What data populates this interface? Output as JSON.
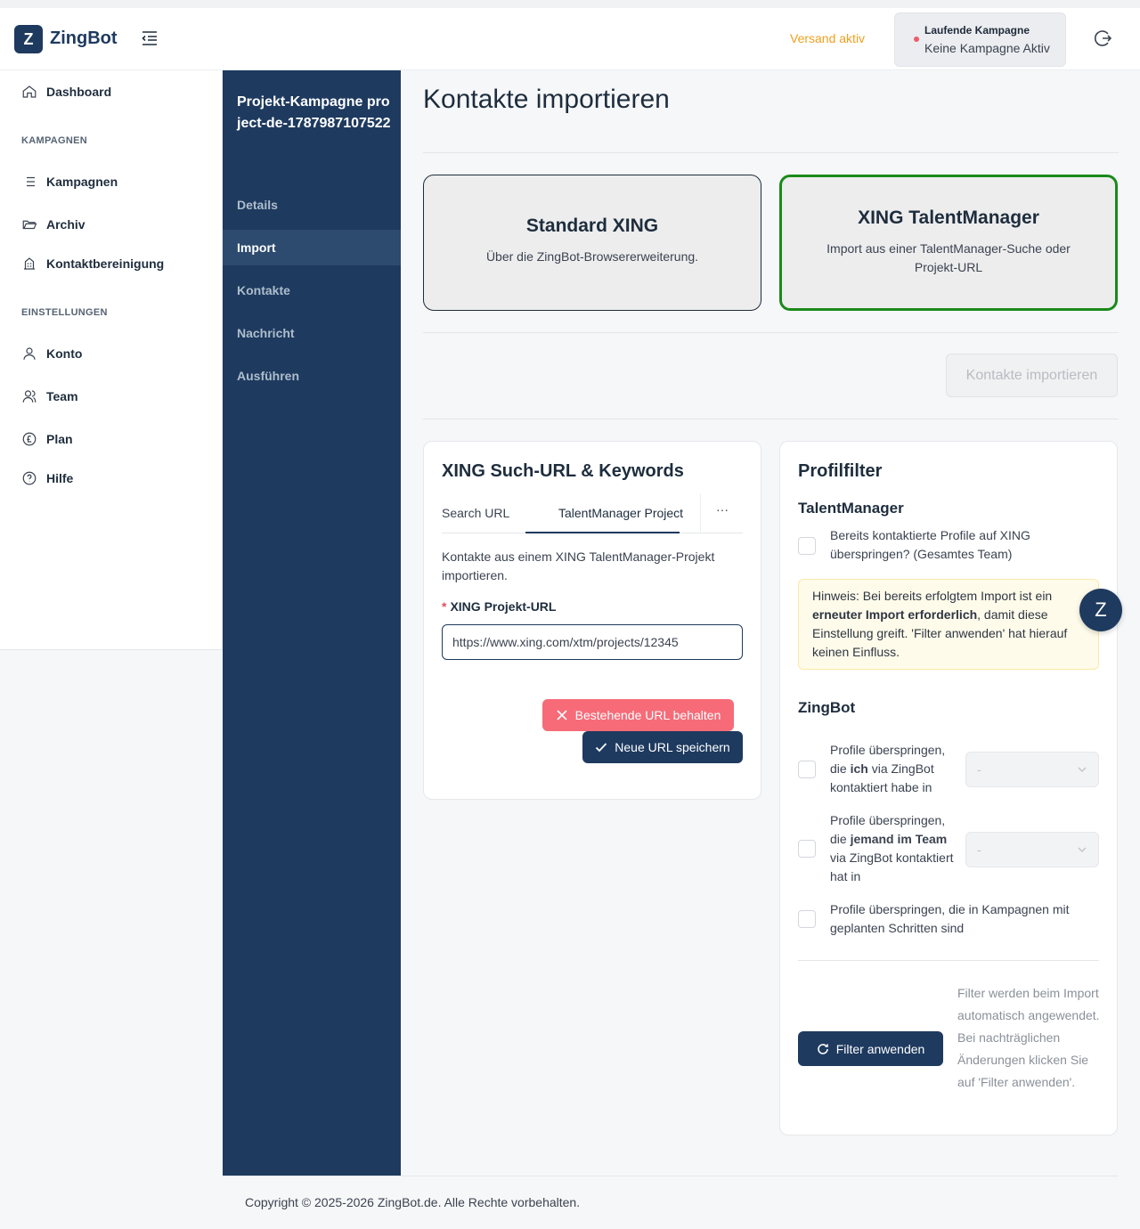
{
  "header": {
    "logo_letter": "Z",
    "app_name": "ZingBot",
    "versand_status": "Versand aktiv",
    "campaign_label": "Laufende Kampagne",
    "campaign_value": "Keine Kampagne Aktiv"
  },
  "sidebar": {
    "dashboard": "Dashboard",
    "section_campaigns": "KAMPAGNEN",
    "campaigns": "Kampagnen",
    "archive": "Archiv",
    "cleanup": "Kontaktbereinigung",
    "section_settings": "EINSTELLUNGEN",
    "account": "Konto",
    "team": "Team",
    "plan": "Plan",
    "help": "Hilfe"
  },
  "project_nav": {
    "title": "Projekt-Kampagne project-de-1787987107522",
    "items": [
      "Details",
      "Import",
      "Kontakte",
      "Nachricht",
      "Ausführen"
    ]
  },
  "main": {
    "title": "Kontakte importieren",
    "card_standard_title": "Standard XING",
    "card_standard_desc": "Über die ZingBot-Browsererweiterung.",
    "card_tm_title": "XING TalentManager",
    "card_tm_desc": "Import aus einer TalentManager-Suche oder Projekt-URL",
    "import_button": "Kontakte importieren"
  },
  "search_panel": {
    "title": "XING Such-URL & Keywords",
    "tab_search": "Search URL",
    "tab_tm": "TalentManager Project",
    "tab_more": "···",
    "description": "Kontakte aus einem XING TalentManager-Projekt importieren.",
    "url_label": "XING Projekt-URL",
    "url_value": "https://www.xing.com/xtm/projects/12345",
    "keep_button": "Bestehende URL behalten",
    "save_button": "Neue URL speichern"
  },
  "filter_panel": {
    "title": "Profilfilter",
    "tm_heading": "TalentManager",
    "tm_skip_label": "Bereits kontaktierte Profile auf XING überspringen? (Gesamtes Team)",
    "hint_pre": "Hinweis: Bei bereits erfolgtem Import ist ein ",
    "hint_bold": "erneuter Import erforderlich",
    "hint_post": ", damit diese Einstellung greift. 'Filter anwenden' hat hierauf keinen Einfluss.",
    "zingbot_heading": "ZingBot",
    "skip_me_pre": "Profile überspringen, die ",
    "skip_me_bold": "ich",
    "skip_me_post": " via ZingBot kontaktiert habe in",
    "skip_team_pre": "Profile überspringen, die ",
    "skip_team_bold": "jemand im Team",
    "skip_team_post": " via ZingBot kontaktiert hat in",
    "select_placeholder": "-",
    "skip_planned": "Profile überspringen, die in Kampagnen mit geplanten Schritten sind",
    "apply_button": "Filter anwenden",
    "apply_note": "Filter werden beim Import automatisch angewendet. Bei nachträglichen Änderungen klicken Sie auf 'Filter anwenden'."
  },
  "fab_letter": "Z",
  "footer": "Copyright © 2025-2026 ZingBot.de. Alle Rechte vorbehalten.",
  "colors": {
    "primary": "#1e3a5f",
    "versand": "#f0a020",
    "selected_border": "#1a8a1a",
    "danger": "#f76b78"
  }
}
